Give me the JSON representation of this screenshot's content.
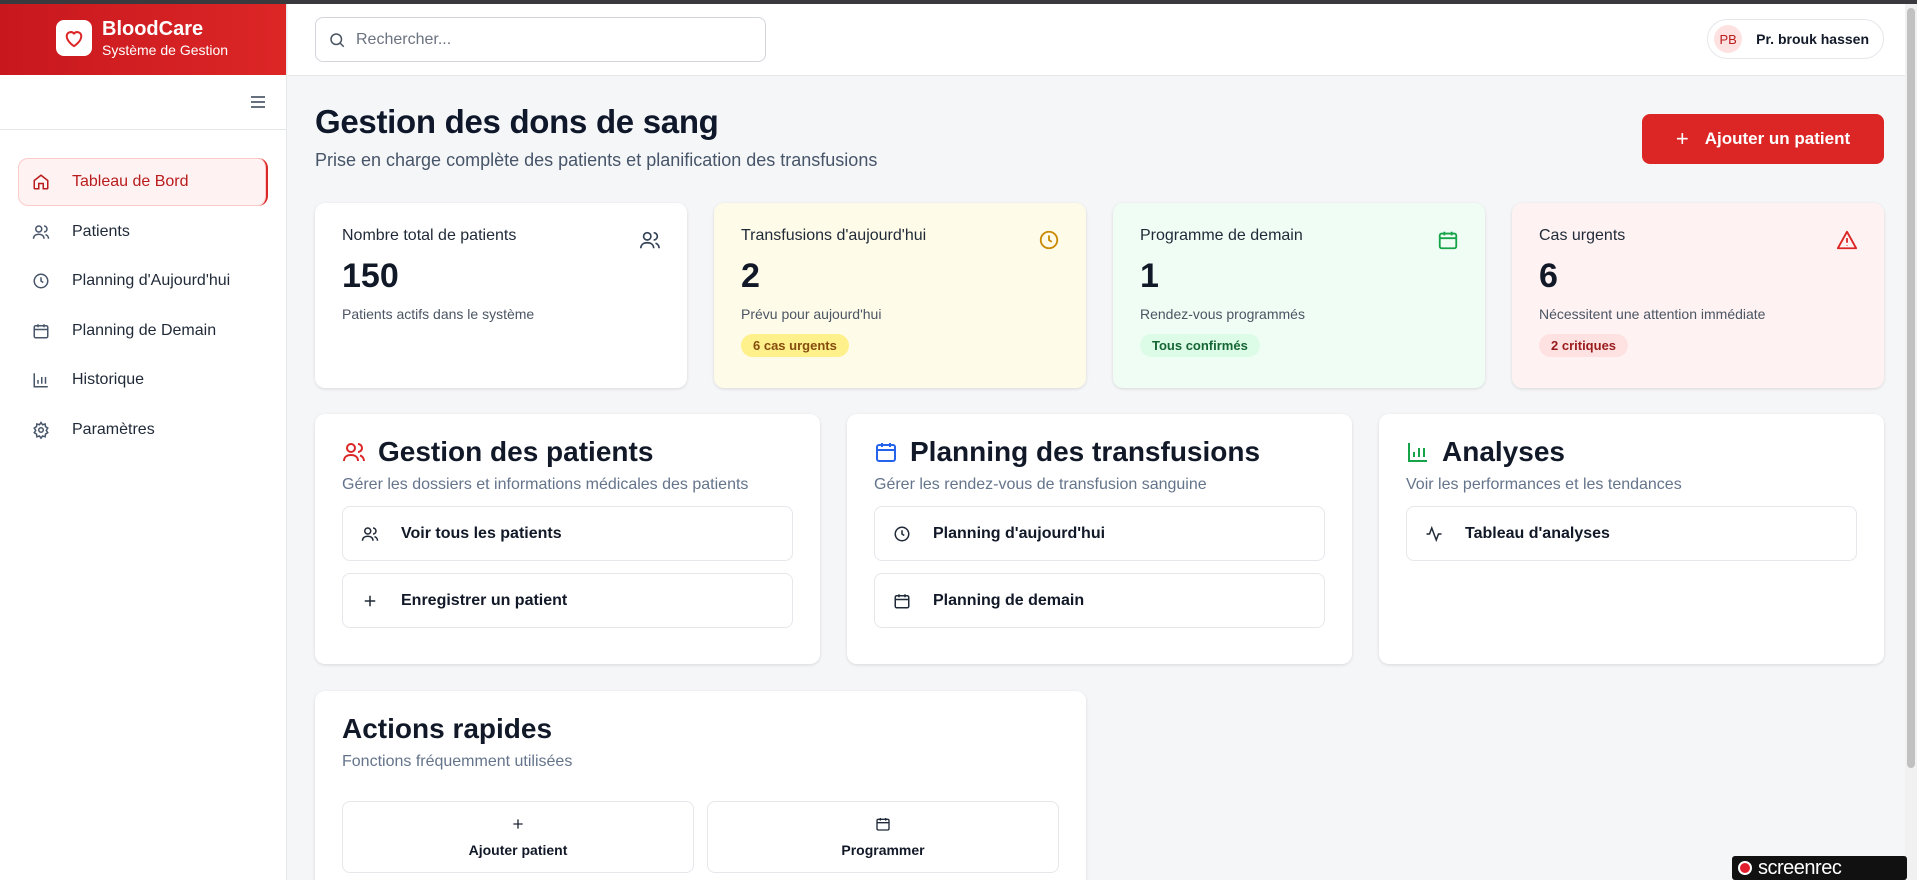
{
  "brand": {
    "name": "BloodCare",
    "subtitle": "Système de Gestion"
  },
  "sidebar": {
    "items": [
      {
        "label": "Tableau de Bord",
        "icon": "home-icon",
        "active": true
      },
      {
        "label": "Patients",
        "icon": "users-icon"
      },
      {
        "label": "Planning d'Aujourd'hui",
        "icon": "clock-icon"
      },
      {
        "label": "Planning de Demain",
        "icon": "calendar-icon"
      },
      {
        "label": "Historique",
        "icon": "bar-chart-icon"
      },
      {
        "label": "Paramètres",
        "icon": "gear-icon"
      }
    ]
  },
  "search": {
    "placeholder": "Rechercher..."
  },
  "user": {
    "initials": "PB",
    "name": "Pr. brouk hassen"
  },
  "header": {
    "title": "Gestion des dons de sang",
    "subtitle": "Prise en charge complète des patients et planification des transfusions",
    "add_button": "Ajouter un patient"
  },
  "stats": [
    {
      "label": "Nombre total de patients",
      "value": "150",
      "desc": "Patients actifs dans le système",
      "badge": "",
      "bg": "#ffffff",
      "accent": "#334155"
    },
    {
      "label": "Transfusions d'aujourd'hui",
      "value": "2",
      "desc": "Prévu pour aujourd'hui",
      "badge": "6 cas urgents",
      "bg": "#fefbe8",
      "accent": "#ca8a04"
    },
    {
      "label": "Programme de demain",
      "value": "1",
      "desc": "Rendez-vous programmés",
      "badge": "Tous confirmés",
      "bg": "#effdf4",
      "accent": "#16a34a"
    },
    {
      "label": "Cas urgents",
      "value": "6",
      "desc": "Nécessitent une attention immédiate",
      "badge": "2 critiques",
      "bg": "#fef2f2",
      "accent": "#dc2626"
    }
  ],
  "cards": [
    {
      "title": "Gestion des patients",
      "subtitle": "Gérer les dossiers et informations médicales des patients",
      "buttons": [
        "Voir tous les patients",
        "Enregistrer un patient"
      ]
    },
    {
      "title": "Planning des transfusions",
      "subtitle": "Gérer les rendez-vous de transfusion sanguine",
      "buttons": [
        "Planning d'aujourd'hui",
        "Planning de demain"
      ]
    },
    {
      "title": "Analyses",
      "subtitle": "Voir les performances et les tendances",
      "buttons": [
        "Tableau d'analyses"
      ]
    }
  ],
  "quick": {
    "title": "Actions rapides",
    "subtitle": "Fonctions fréquemment utilisées",
    "buttons": [
      "Ajouter patient",
      "Programmer"
    ]
  },
  "watermark": "screenrec"
}
